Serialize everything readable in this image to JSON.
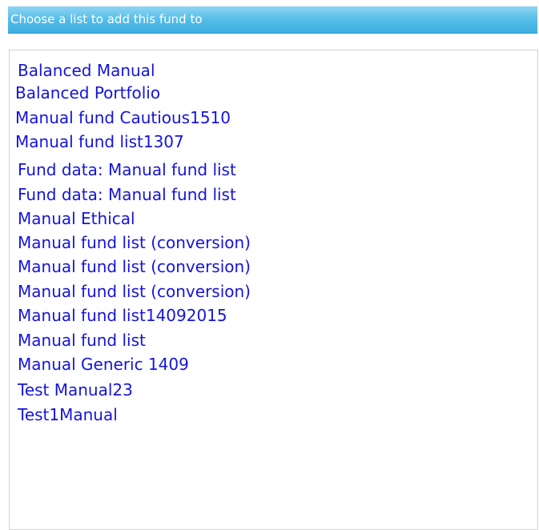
{
  "header": {
    "title": "Choose a list to add this fund to"
  },
  "lists": [
    "Balanced Manual",
    "Balanced Portfolio",
    "Manual fund Cautious1510",
    "Manual fund list1307",
    "Fund data: Manual fund list",
    "Fund data: Manual fund list",
    "Manual Ethical",
    "Manual fund list (conversion)",
    "Manual fund list (conversion)",
    "Manual fund list (conversion)",
    "Manual fund list14092015",
    "Manual fund list",
    "Manual Generic 1409",
    "Test Manual23",
    "Test1Manual"
  ],
  "colors": {
    "header_bg": "#55bde9",
    "link": "#1414dc",
    "border": "#d4d4d4"
  }
}
